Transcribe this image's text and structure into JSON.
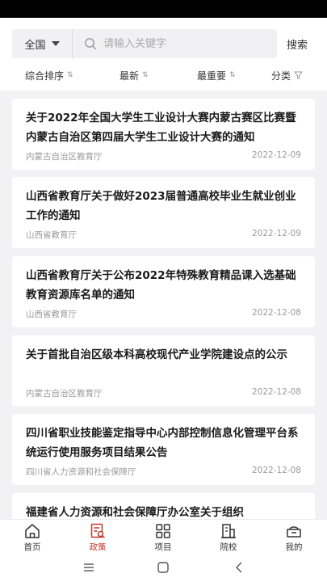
{
  "search": {
    "scope_label": "全国",
    "placeholder": "请输入关键字",
    "button_label": "搜索"
  },
  "sort": [
    {
      "label": "综合排序",
      "icon": "sort-arrows-icon"
    },
    {
      "label": "最新",
      "icon": "sort-arrows-icon"
    },
    {
      "label": "最重要",
      "icon": "sort-arrows-icon"
    },
    {
      "label": "分类",
      "icon": "filter-icon"
    }
  ],
  "news": [
    {
      "title": "关于2022年全国大学生工业设计大赛内蒙古赛区比赛暨内蒙古自治区第四届大学生工业设计大赛的通知",
      "source": "内蒙古自治区教育厅",
      "date": "2022-12-09"
    },
    {
      "title": "山西省教育厅关于做好2023届普通高校毕业生就业创业工作的通知",
      "source": "山西省教育厅",
      "date": "2022-12-09"
    },
    {
      "title": "山西省教育厅关于公布2022年特殊教育精品课入选基础教育资源库名单的通知",
      "source": "山西省教育厅",
      "date": "2022-12-08"
    },
    {
      "title": "关于首批自治区级本科高校现代产业学院建设点的公示",
      "source": "内蒙古自治区教育厅",
      "date": "2022-12-08"
    },
    {
      "title": "四川省职业技能鉴定指导中心内部控制信息化管理平台系统运行使用服务项目结果公告",
      "source": "四川省人力资源和社会保障厅",
      "date": "2022-12-08"
    },
    {
      "title": "福建省人力资源和社会保障厅办公室关于组织",
      "source": "",
      "date": ""
    }
  ],
  "tabs": [
    {
      "label": "首页",
      "icon": "home-icon",
      "active": false
    },
    {
      "label": "政策",
      "icon": "policy-document-icon",
      "active": true
    },
    {
      "label": "项目",
      "icon": "grid-icon",
      "active": false
    },
    {
      "label": "院校",
      "icon": "building-icon",
      "active": false
    },
    {
      "label": "我的",
      "icon": "profile-icon",
      "active": false
    }
  ],
  "colors": {
    "accent": "#c0392b",
    "list_background": "#f2f2f4",
    "search_background": "#f1f1f3"
  }
}
